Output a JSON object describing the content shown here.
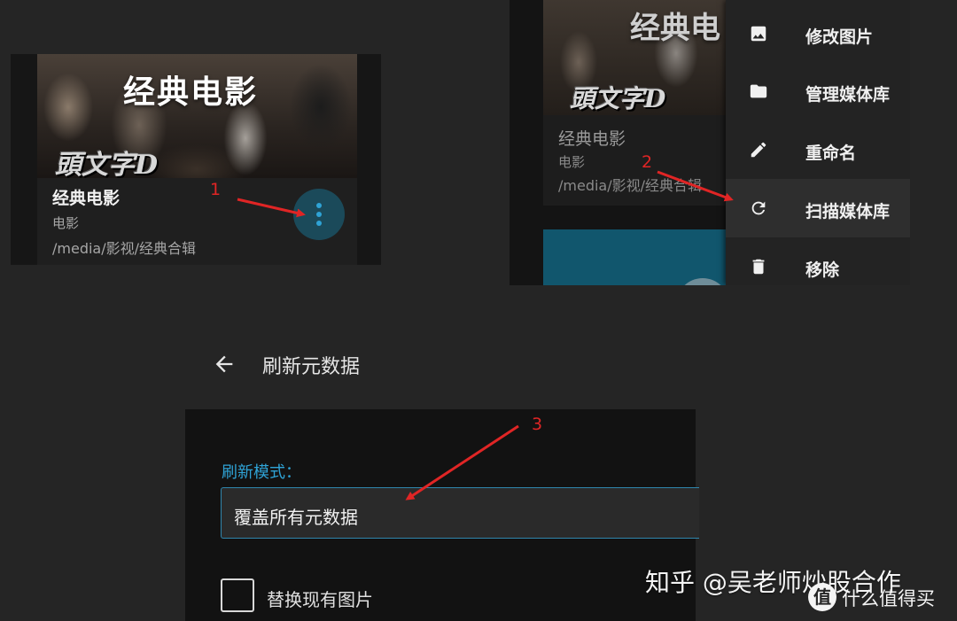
{
  "library_card": {
    "poster_title": "经典电影",
    "poster_logo": "頭文字D",
    "title": "经典电影",
    "type": "电影",
    "path": "/media/影视/经典合辑",
    "more_icon": "more-vert-icon",
    "accent": "#2fa3d6"
  },
  "background_card": {
    "poster_title": "经典电",
    "poster_logo": "頭文字D",
    "title": "经典电影",
    "type": "电影",
    "path": "/media/影视/经典合辑"
  },
  "context_menu": {
    "items": [
      {
        "icon": "image-icon",
        "label": "修改图片"
      },
      {
        "icon": "folder-icon",
        "label": "管理媒体库"
      },
      {
        "icon": "pencil-icon",
        "label": "重命名"
      },
      {
        "icon": "refresh-icon",
        "label": "扫描媒体库",
        "highlighted": true
      },
      {
        "icon": "trash-icon",
        "label": "移除"
      }
    ]
  },
  "refresh_dialog": {
    "title": "刷新元数据",
    "mode_label": "刷新模式：",
    "mode_value": "覆盖所有元数据",
    "replace_images_label": "替换现有图片",
    "replace_images_checked": false
  },
  "annotations": [
    "1",
    "2",
    "3"
  ],
  "annotation_color": "#e02525",
  "watermark": {
    "text": "知乎 @吴老师炒股合作",
    "sub": "什么值得买"
  }
}
